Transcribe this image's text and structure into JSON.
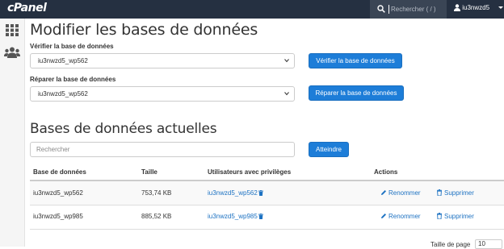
{
  "app": {
    "logo": "cPanel"
  },
  "topbar": {
    "search_placeholder": "Rechercher ( / )",
    "username": "iu3nwzd5"
  },
  "page": {
    "title": "Modifier les bases de données",
    "check_label": "Vérifier la base de données",
    "check_select_value": "iu3nwzd5_wp562",
    "check_button": "Vérifier la base de données",
    "repair_label": "Réparer la base de données",
    "repair_select_value": "iu3nwzd5_wp562",
    "repair_button": "Réparer la base de données"
  },
  "current": {
    "title": "Bases de données actuelles",
    "search_placeholder": "Rechercher",
    "search_button": "Atteindre",
    "columns": [
      "Base de données",
      "Taille",
      "Utilisateurs avec privilèges",
      "Actions"
    ],
    "rows": [
      {
        "name": "iu3nwzd5_wp562",
        "size": "753,74 KB",
        "user": "iu3nwzd5_wp562",
        "rename": "Renommer",
        "delete": "Supprimer"
      },
      {
        "name": "iu3nwzd5_wp985",
        "size": "885,52 KB",
        "user": "iu3nwzd5_wp985",
        "rename": "Renommer",
        "delete": "Supprimer"
      }
    ],
    "page_size_label": "Taille de page",
    "page_size_value": "10"
  },
  "colors": {
    "topbar": "#253041",
    "primary_button": "#1d7dd8",
    "link": "#1d72c2"
  },
  "icons": [
    "search-icon",
    "user-icon",
    "grid-icon",
    "users-icon",
    "trash-icon",
    "pencil-icon",
    "chevron-down-icon"
  ]
}
